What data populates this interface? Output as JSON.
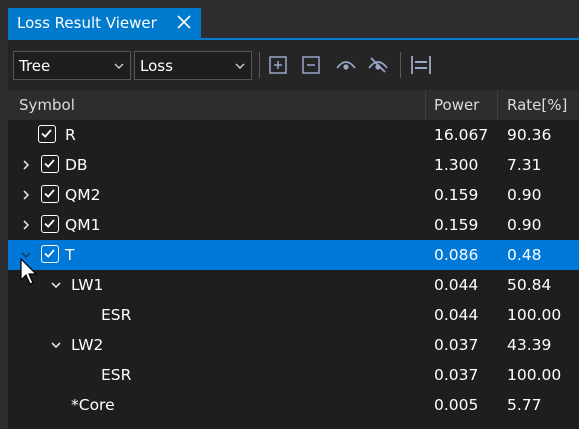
{
  "tab": {
    "title": "Loss Result Viewer"
  },
  "toolbar": {
    "view_select": "Tree",
    "type_select": "Loss",
    "buttons": [
      "expand-all-icon",
      "collapse-all-icon",
      "show-icon",
      "hide-icon",
      "fit-columns-icon"
    ]
  },
  "columns": {
    "symbol": "Symbol",
    "power": "Power",
    "rate": "Rate[%]"
  },
  "rows": [
    {
      "symbol": "R",
      "power": "16.067",
      "rate": "90.36",
      "checkbox": true,
      "expander": "none"
    },
    {
      "symbol": "DB",
      "power": "1.300",
      "rate": "7.31",
      "checkbox": true,
      "expander": "collapsed"
    },
    {
      "symbol": "QM2",
      "power": "0.159",
      "rate": "0.90",
      "checkbox": true,
      "expander": "collapsed"
    },
    {
      "symbol": "QM1",
      "power": "0.159",
      "rate": "0.90",
      "checkbox": true,
      "expander": "collapsed"
    },
    {
      "symbol": "T",
      "power": "0.086",
      "rate": "0.48",
      "checkbox": true,
      "expander": "expanded",
      "selected": true
    },
    {
      "symbol": "LW1",
      "power": "0.044",
      "rate": "50.84",
      "checkbox": false,
      "expander": "expanded"
    },
    {
      "symbol": "ESR",
      "power": "0.044",
      "rate": "100.00",
      "checkbox": false,
      "expander": "none"
    },
    {
      "symbol": "LW2",
      "power": "0.037",
      "rate": "43.39",
      "checkbox": false,
      "expander": "expanded"
    },
    {
      "symbol": "ESR",
      "power": "0.037",
      "rate": "100.00",
      "checkbox": false,
      "expander": "none"
    },
    {
      "symbol": "*Core",
      "power": "0.005",
      "rate": "5.77",
      "checkbox": false,
      "expander": "none"
    }
  ],
  "colors": {
    "accent": "#007acc",
    "selected_row": "#0078d7",
    "background": "#1e1e1e"
  }
}
